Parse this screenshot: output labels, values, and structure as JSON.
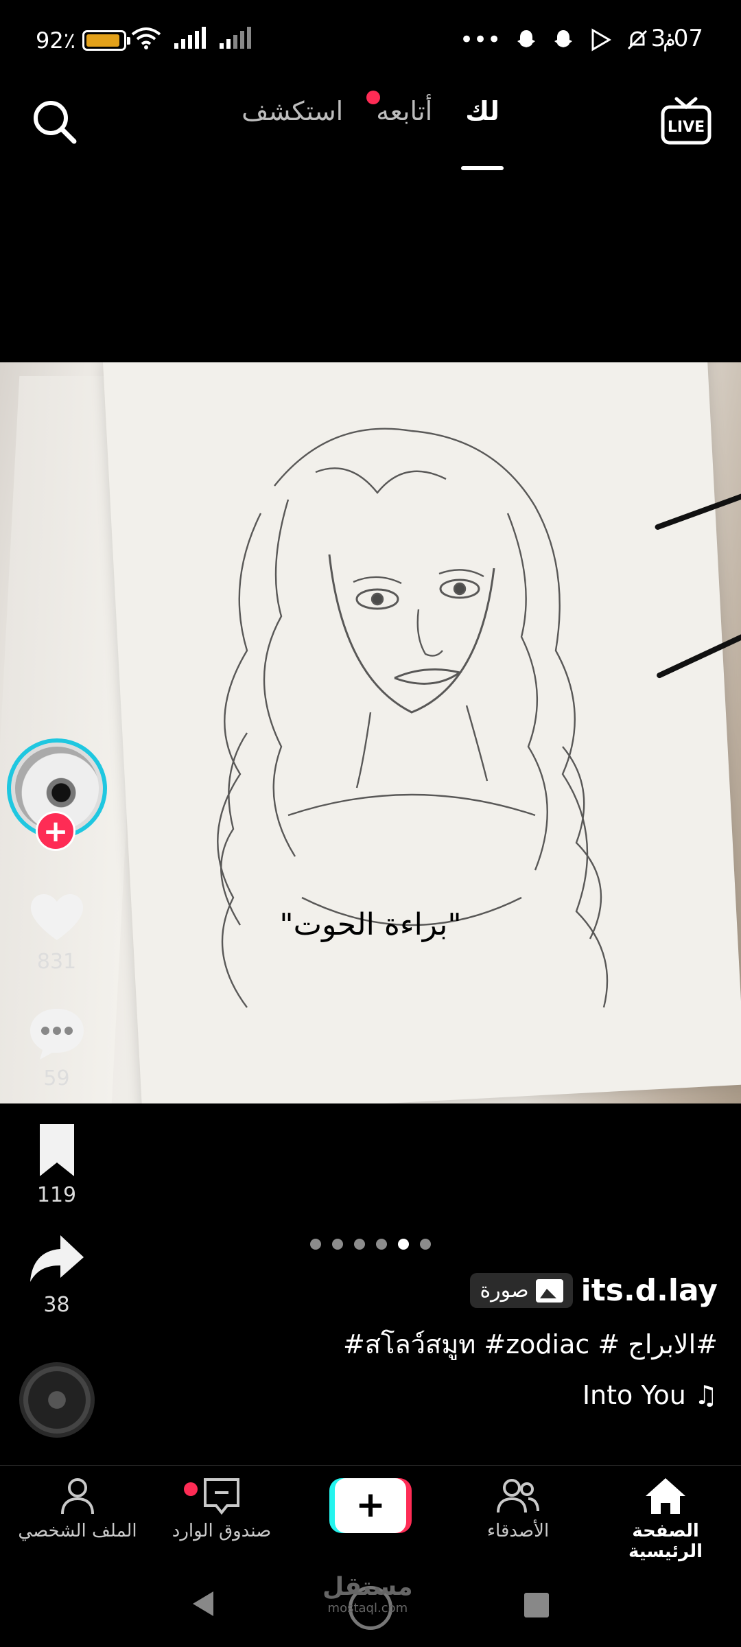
{
  "status_bar": {
    "time": "3:07",
    "am_pm": "م",
    "battery_text": "92٪",
    "battery_level": 0.92,
    "colors": {
      "battery_fill": "#e3a11a"
    }
  },
  "top_nav": {
    "tabs": [
      {
        "label": "لك",
        "active": true
      },
      {
        "label": "أتابعه",
        "active": false,
        "has_dot": true
      },
      {
        "label": "استكشف",
        "active": false
      }
    ],
    "live_label": "LIVE"
  },
  "post": {
    "overlay_caption": "\"براءة الحوت\"",
    "likes": "831",
    "comments": "59",
    "saves": "119",
    "shares": "38",
    "pager": {
      "total": 6,
      "current_index": 4
    },
    "username": "its.d.lay",
    "type_label": "صورة",
    "description": "#الابراج # สโลว์สมูท #zodiac#",
    "music": "Into You ♫",
    "colors": {
      "accent": "#fe2c55",
      "ring": "#1fc7e0"
    }
  },
  "bottom_nav": {
    "home": "الصفحة الرئيسية",
    "friends": "الأصدقاء",
    "inbox": "صندوق الوارد",
    "profile": "الملف الشخصي",
    "create": "+"
  },
  "watermark": {
    "main": "مستقل",
    "sub": "mostaql.com"
  }
}
